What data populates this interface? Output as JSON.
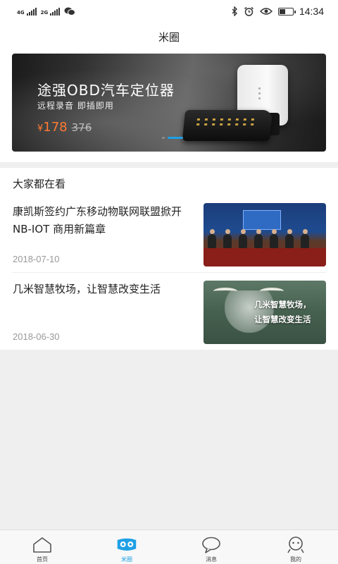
{
  "status_bar": {
    "net1": "4G",
    "net2": "2G",
    "time": "14:34",
    "icons": [
      "signal-icon",
      "signal-icon",
      "wechat-icon",
      "bluetooth-icon",
      "alarm-icon",
      "eye-icon",
      "battery-icon"
    ]
  },
  "header": {
    "title": "米圈"
  },
  "banner": {
    "title": "途强OBD汽车定位器",
    "subtitle": "远程录音  即插即用",
    "currency": "¥",
    "price": "178",
    "original_price": "376",
    "page_count": 2,
    "active_page": 2,
    "accent_color": "#1ea0e6",
    "price_color": "#ff7a33"
  },
  "news": {
    "section_title": "大家都在看",
    "items": [
      {
        "title": "康凯斯签约广东移动物联网联盟掀开NB-IOT 商用新篇章",
        "date": "2018-07-10"
      },
      {
        "title": "几米智慧牧场，让智慧改变生活",
        "date": "2018-06-30",
        "thumb_caption_1": "几米智慧牧场，",
        "thumb_caption_2": "让智慧改变生活"
      }
    ]
  },
  "tabbar": {
    "items": [
      {
        "label": "首页",
        "icon": "home-icon",
        "active": false
      },
      {
        "label": "米圈",
        "icon": "owl-icon",
        "active": true
      },
      {
        "label": "消息",
        "icon": "chat-bubble-icon",
        "active": false
      },
      {
        "label": "我的",
        "icon": "profile-icon",
        "active": false
      }
    ]
  }
}
